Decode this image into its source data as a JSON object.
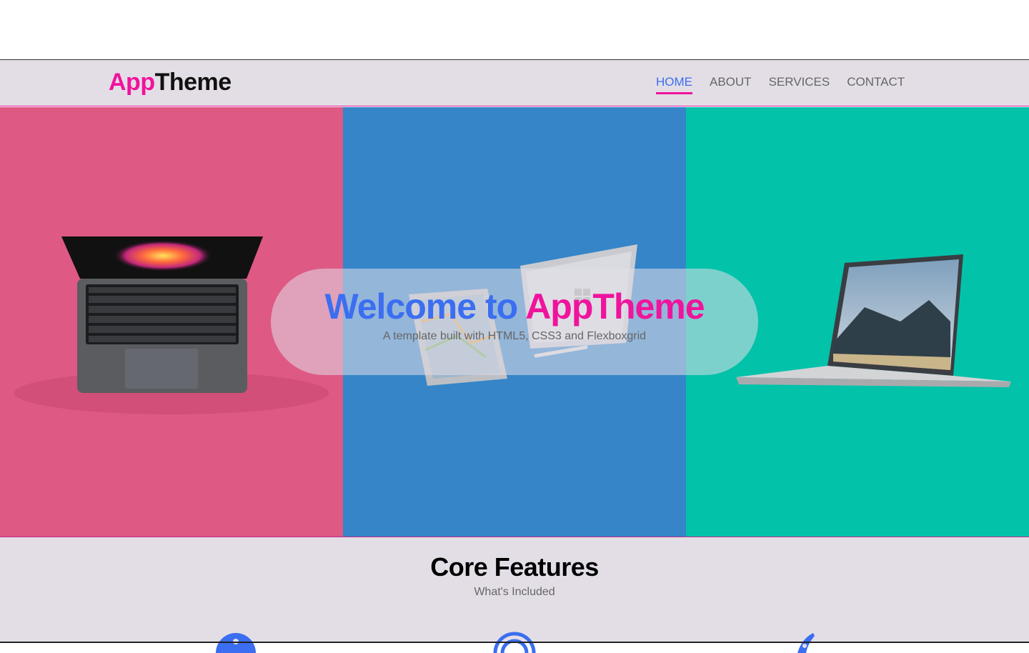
{
  "brand": {
    "logo_part1": "App",
    "logo_part2": "Theme"
  },
  "nav": {
    "items": [
      {
        "label": "HOME",
        "active": true
      },
      {
        "label": "ABOUT",
        "active": false
      },
      {
        "label": "SERVICES",
        "active": false
      },
      {
        "label": "CONTACT",
        "active": false
      }
    ]
  },
  "hero": {
    "title_part1": "Welcome to",
    "title_part2": "AppTheme",
    "subtitle": "A template built with HTML5, CSS3 and Flexboxgrid",
    "panels": [
      {
        "color": "#de5984",
        "image": "macbook-laptop"
      },
      {
        "color": "#3585c8",
        "image": "surface-book-tablet"
      },
      {
        "color": "#03c2aa",
        "image": "surface-laptop"
      }
    ]
  },
  "features": {
    "title": "Core Features",
    "subtitle": "What's Included",
    "icons": [
      "info-icon",
      "target-icon",
      "rocket-icon"
    ]
  },
  "colors": {
    "accent_pink": "#f0139c",
    "accent_blue": "#3b6ef0",
    "bg": "#e3dee6"
  }
}
